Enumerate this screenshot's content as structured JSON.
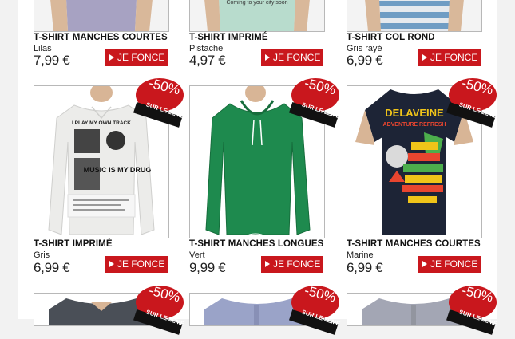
{
  "button_label": "JE FONCE",
  "badge": {
    "percent": "-50%",
    "line1": "SUR LE 2EME"
  },
  "colors": {
    "accent": "#c9171d"
  },
  "products": [
    {
      "title": "T-SHIRT MANCHES COURTES",
      "color": "Lilas",
      "price": "7,99 €"
    },
    {
      "title": "T-SHIRT IMPRIMÉ",
      "color": "Pistache",
      "price": "4,97 €",
      "print": "Coming to your city soon"
    },
    {
      "title": "T-SHIRT COL ROND",
      "color": "Gris rayé",
      "price": "6,99 €"
    },
    {
      "title": "T-SHIRT IMPRIMÉ",
      "color": "Gris",
      "price": "6,99 €",
      "print": "I PLAY MY OWN TRACK",
      "print2": "MUSIC IS MY DRUG"
    },
    {
      "title": "T-SHIRT MANCHES LONGUES",
      "color": "Vert",
      "price": "9,99 €"
    },
    {
      "title": "T-SHIRT MANCHES COURTES",
      "color": "Marine",
      "price": "6,99 €",
      "print": "DELAVEINE",
      "print2": "ADVENTURE REFRESH"
    }
  ]
}
